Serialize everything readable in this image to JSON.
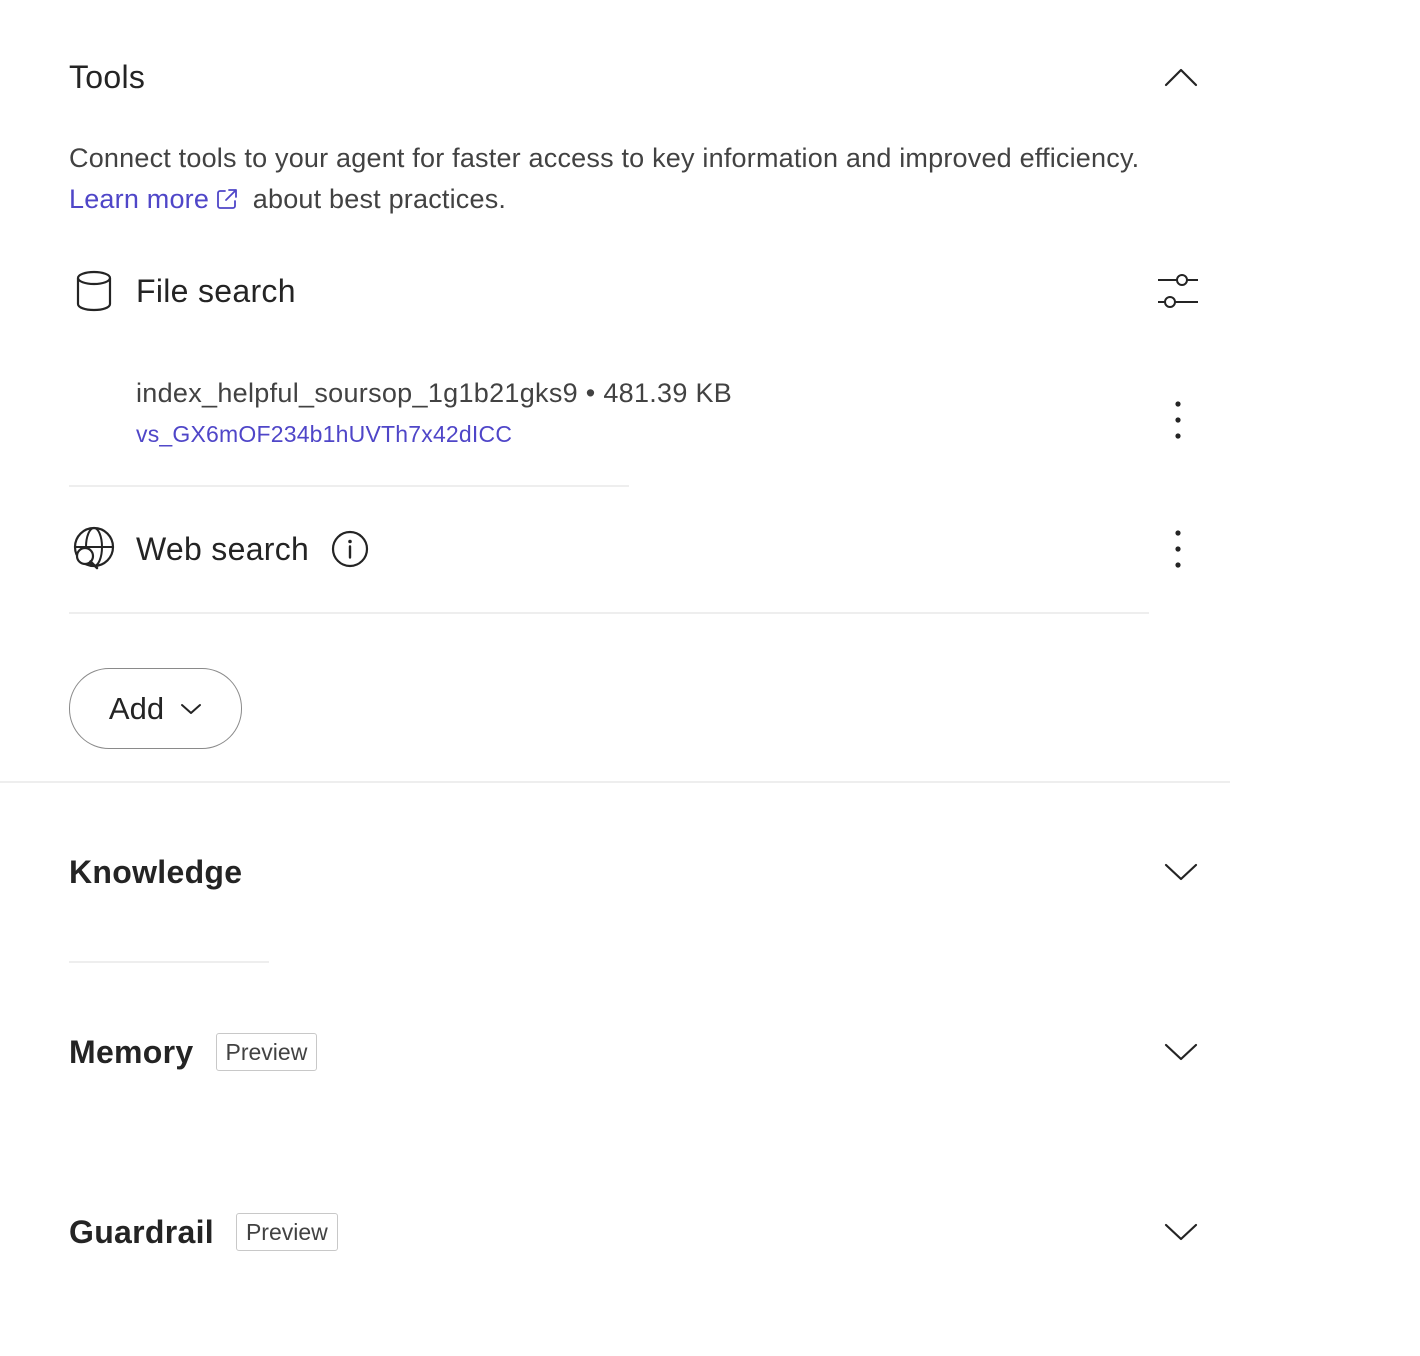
{
  "tools": {
    "title": "Tools",
    "description_part1": "Connect tools to your agent for faster access to key information and improved efficiency.",
    "learn_more_link": "Learn more",
    "description_part2": "about best practices.",
    "items": [
      {
        "label": "File search",
        "icon": "database-icon",
        "action_icon": "settings-sliders-icon",
        "file": {
          "name": "index_helpful_soursop_1g1b21gks9",
          "separator": "•",
          "size": "481.39 KB",
          "id": "vs_GX6mOF234b1hUVTh7x42dICC"
        }
      },
      {
        "label": "Web search",
        "icon": "globe-search-icon",
        "info_icon": "info-icon",
        "action_icon": "more-vertical-icon"
      }
    ],
    "add_button": "Add"
  },
  "sections": [
    {
      "title": "Knowledge",
      "badge": ""
    },
    {
      "title": "Memory",
      "badge": "Preview"
    },
    {
      "title": "Guardrail",
      "badge": "Preview"
    }
  ],
  "colors": {
    "link": "#4f46c8",
    "text": "#242424",
    "muted": "#424242",
    "divider": "#eeeeee"
  }
}
